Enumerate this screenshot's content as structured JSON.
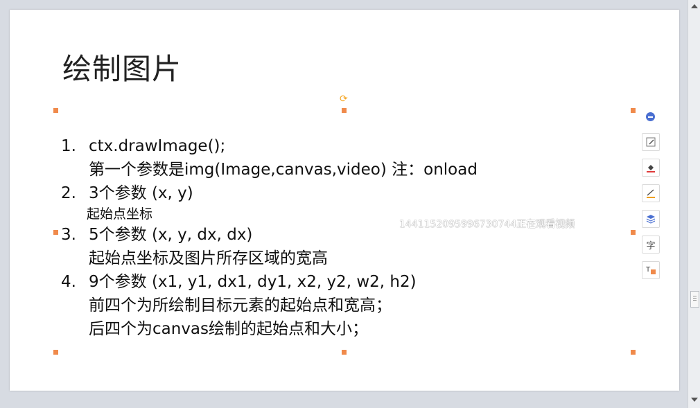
{
  "slide": {
    "title": "绘制图片",
    "items": [
      {
        "num": "1.",
        "text": "ctx.drawImage();",
        "sub": [
          "第一个参数是img(Image,canvas,video) 注：onload"
        ]
      },
      {
        "num": "2.",
        "text": "3个参数  (x, y)",
        "sub": [
          "起始点坐标"
        ]
      },
      {
        "num": "3.",
        "text": "5个参数 (x, y, dx, dx)",
        "sub": [
          "起始点坐标及图片所存区域的宽高"
        ]
      },
      {
        "num": "4.",
        "text": "9个参数 (x1, y1, dx1, dy1, x2, y2, w2, h2)",
        "sub": [
          "前四个为所绘制目标元素的起始点和宽高；",
          "后四个为canvas绘制的起始点和大小；"
        ]
      }
    ]
  },
  "watermark": "1441152095996730744正在观看视频",
  "tools": [
    {
      "icon": "minus-circle-icon"
    },
    {
      "icon": "edit-shape-icon"
    },
    {
      "icon": "fill-color-icon"
    },
    {
      "icon": "line-color-icon"
    },
    {
      "icon": "layers-icon"
    },
    {
      "icon": "text-style-icon"
    },
    {
      "icon": "text-box-icon"
    }
  ],
  "colors": {
    "handle": "#f08a4b",
    "rotate": "#f5a623",
    "accent": "#4a6fd1"
  }
}
